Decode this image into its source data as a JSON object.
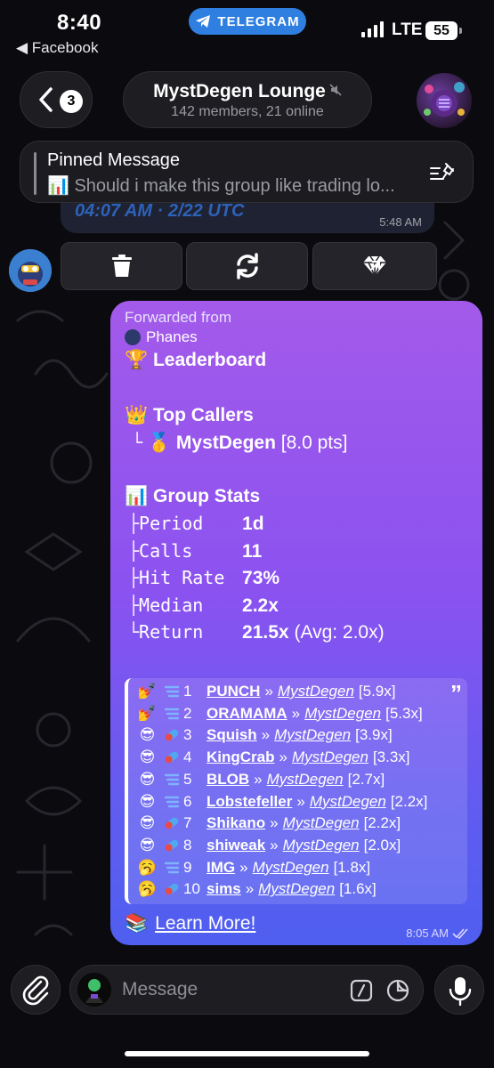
{
  "status_bar": {
    "time": "8:40",
    "back_app": "◀ Facebook",
    "telegram_pill": "TELEGRAM",
    "network": "LTE",
    "battery": "55"
  },
  "header": {
    "back_count": "3",
    "title": "MystDegen Lounge",
    "subtitle": "142 members, 21 online",
    "muted": true
  },
  "pinned": {
    "title": "Pinned Message",
    "text": "📊 Should i make this group like trading lo..."
  },
  "previous_message": {
    "italic_text": "04:07 AM · 2/22 UTC",
    "time": "5:48 AM"
  },
  "inline_buttons": [
    {
      "icon": "trash-icon"
    },
    {
      "icon": "refresh-icon"
    },
    {
      "icon": "diamond-icon"
    }
  ],
  "message": {
    "forwarded_label": "Forwarded from",
    "forwarded_from": "Phanes",
    "leaderboard_title": "🏆 Leaderboard",
    "top_callers_title": "👑 Top Callers",
    "top_caller_prefix": "└",
    "top_caller_medal": "🥇",
    "top_caller_name": "MystDegen",
    "top_caller_points": "[8.0 pts]",
    "group_stats_title": "📊 Group Stats",
    "stats": [
      {
        "tree": "├",
        "label": "Period",
        "value": "1d"
      },
      {
        "tree": "├",
        "label": "Calls",
        "value": "11"
      },
      {
        "tree": "├",
        "label": "Hit Rate",
        "value": "73%"
      },
      {
        "tree": "├",
        "label": "Median",
        "value": "2.2x"
      },
      {
        "tree": "└",
        "label": "Return",
        "value": "21.5x",
        "extra": "(Avg: 2.0x)"
      }
    ],
    "calls": [
      {
        "rank": "1",
        "token": "PUNCH",
        "caller": "MystDegen",
        "mult": "[5.9x]"
      },
      {
        "rank": "2",
        "token": "ORAMAMA",
        "caller": "MystDegen",
        "mult": "[5.3x]"
      },
      {
        "rank": "3",
        "token": "Squish",
        "caller": "MystDegen",
        "mult": "[3.9x]"
      },
      {
        "rank": "4",
        "token": "KingCrab",
        "caller": "MystDegen",
        "mult": "[3.3x]"
      },
      {
        "rank": "5",
        "token": "BLOB",
        "caller": "MystDegen",
        "mult": "[2.7x]"
      },
      {
        "rank": "6",
        "token": "Lobstefeller",
        "caller": "MystDegen",
        "mult": "[2.2x]"
      },
      {
        "rank": "7",
        "token": "Shikano",
        "caller": "MystDegen",
        "mult": "[2.2x]"
      },
      {
        "rank": "8",
        "token": "shiweak",
        "caller": "MystDegen",
        "mult": "[2.0x]"
      },
      {
        "rank": "9",
        "token": "IMG",
        "caller": "MystDegen",
        "mult": "[1.8x]"
      },
      {
        "rank": "10",
        "token": "sims",
        "caller": "MystDegen",
        "mult": "[1.6x]"
      }
    ],
    "separator": "»",
    "quote_mark": "”",
    "learn_more": "Learn More!",
    "time": "8:05 AM"
  },
  "input": {
    "placeholder": "Message"
  },
  "colors": {
    "bubble_top": "#a35aea",
    "bubble_bottom": "#4f5ff0",
    "telegram_blue": "#2f7fe0"
  }
}
